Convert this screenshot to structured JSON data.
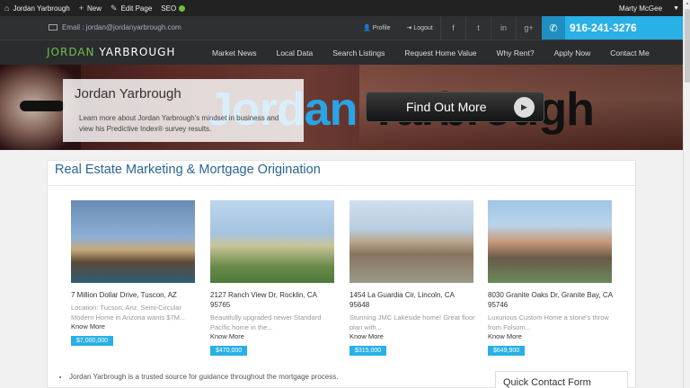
{
  "admin_bar": {
    "site_name": "Jordan Yarbrough",
    "new_label": "New",
    "edit_label": "Edit Page",
    "seo_label": "SEO",
    "user_name": "Marty McGee"
  },
  "top_bar": {
    "email": "Email : jordan@jordanyarbrough.com",
    "profile_label": "Profile",
    "logout_label": "Logout",
    "social": [
      "f",
      "t",
      "in",
      "g+"
    ],
    "phone": "916-241-3276"
  },
  "nav": {
    "logo_first": "JORDAN ",
    "logo_last": "YARBROUGH",
    "items": [
      "Market News",
      "Local Data",
      "Search Listings",
      "Request Home Value",
      "Why Rent?",
      "Apply Now",
      "Contact Me"
    ]
  },
  "banner": {
    "card_name": "Jordan Yarbrough",
    "card_desc": "Learn more about Jordan Yarbrough's mindset in business and view his Predictive Index® survey results.",
    "big_blue": "Jordan",
    "big_dark": " Yarbrough",
    "cta_label": "Find Out More"
  },
  "content": {
    "heading": "Real Estate Marketing & Mortgage Origination",
    "listings": [
      {
        "address": "7 Million Dollar Drive, Tuscon, AZ",
        "blurb": "Location: Tucson, Ariz. Semi-Circular Modern Home in Arizona wants $7M...",
        "more": "Know More",
        "price": "$7,000,000"
      },
      {
        "address": "2127 Ranch View Dr, Rocklin, CA 95765",
        "blurb": "Beautifully upgraded newer Standard Pacific home in the...",
        "more": "Know More",
        "price": "$470,000"
      },
      {
        "address": "1454 La Guardia Cir, Lincoln, CA 95648",
        "blurb": "Stunning JMC Lakeside home! Great floor plan with...",
        "more": "Know More",
        "price": "$315,000"
      },
      {
        "address": "8030 Granite Oaks Dr, Granite Bay, CA 95746",
        "blurb": "Luxurious Custom Home a stone's throw from Folsom...",
        "more": "Know More",
        "price": "$649,900"
      }
    ],
    "bullet": "Jordan Yarbrough is a trusted source for guidance throughout the mortgage process.",
    "quick_contact_title": "Quick Contact Form"
  }
}
